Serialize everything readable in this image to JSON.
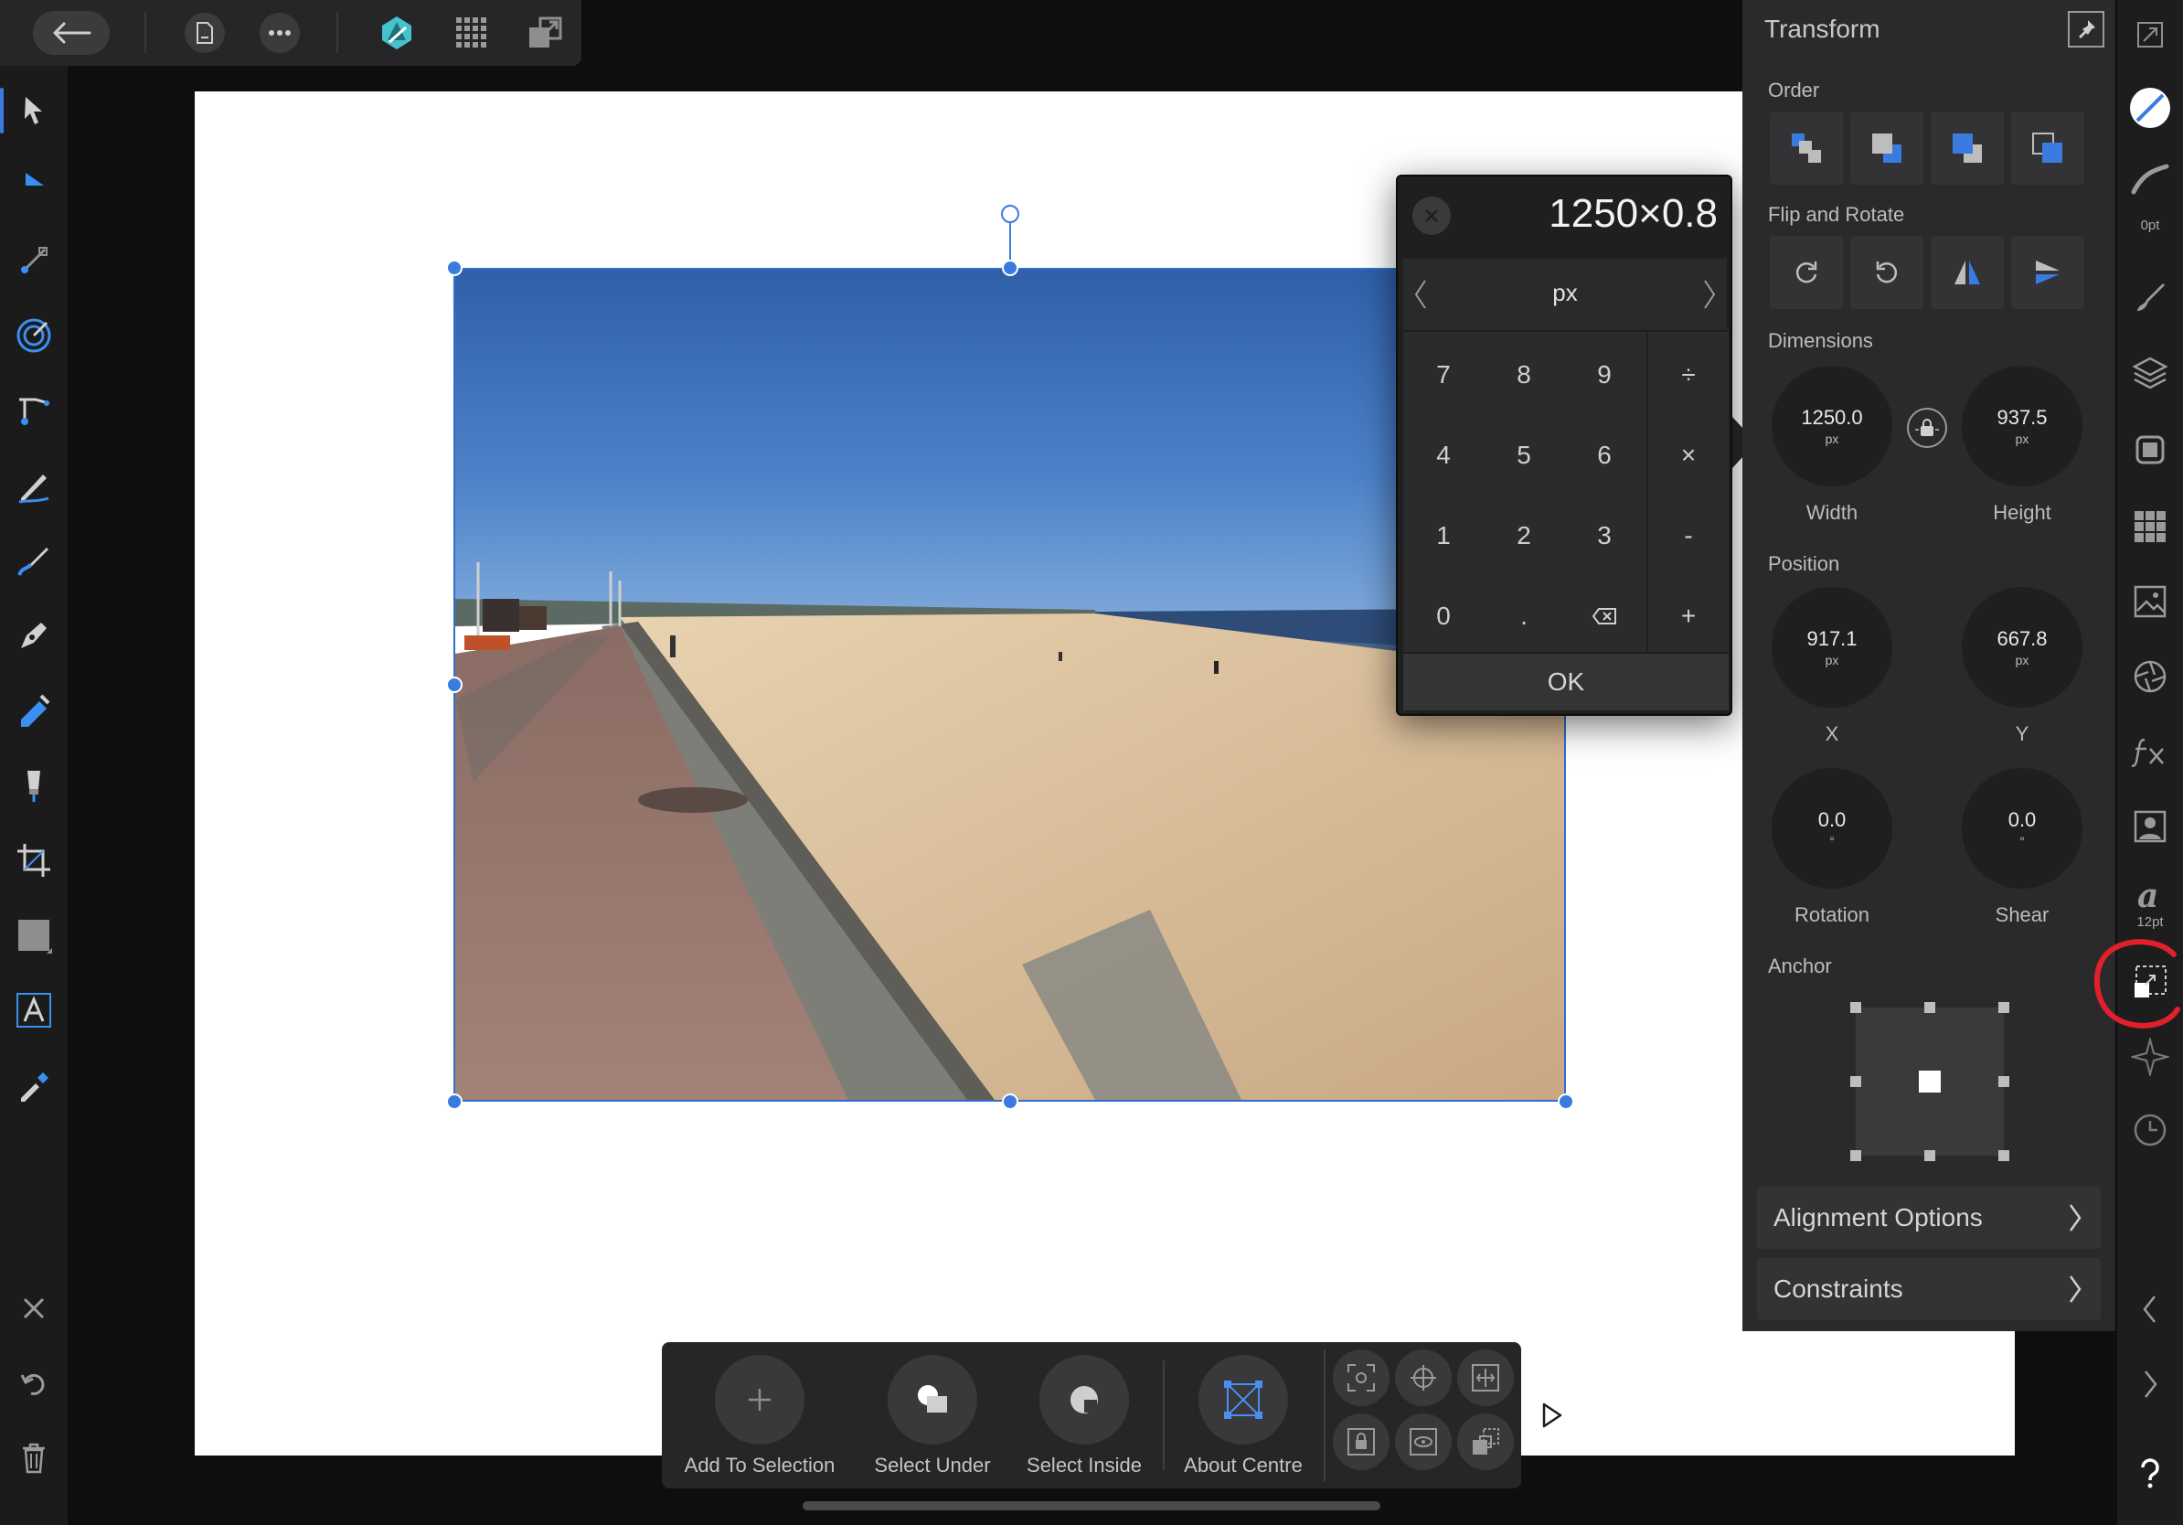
{
  "top_bar": {
    "back_icon": "back-arrow-icon",
    "document_icon": "document-icon",
    "more_icon": "more-icon",
    "persona_icon": "affinity-photo-persona-icon",
    "grid_icon": "grid-icon",
    "export_persona_icon": "export-persona-icon"
  },
  "left_tools": [
    "move-tool",
    "node-tool",
    "point-transform-tool",
    "contour-tool",
    "corner-tool",
    "pencil-tool",
    "vector-brush-tool",
    "pen-tool",
    "fill-tool",
    "transparency-tool",
    "crop-tool",
    "rectangle-tool",
    "artistic-text-tool",
    "color-picker-tool"
  ],
  "left_bottom": [
    "close-icon",
    "undo-icon",
    "delete-icon"
  ],
  "calculator": {
    "expression": "1250×0.8",
    "unit": "px",
    "keys": [
      [
        "7",
        "8",
        "9"
      ],
      [
        "4",
        "5",
        "6"
      ],
      [
        "1",
        "2",
        "3"
      ],
      [
        "0",
        "."
      ]
    ],
    "ops": [
      "÷",
      "×",
      "-",
      "+"
    ],
    "ok_label": "OK"
  },
  "transform": {
    "title": "Transform",
    "order_label": "Order",
    "flip_rotate_label": "Flip and Rotate",
    "dimensions_label": "Dimensions",
    "width": {
      "value": "1250.0",
      "unit": "px",
      "label": "Width"
    },
    "height": {
      "value": "937.5",
      "unit": "px",
      "label": "Height"
    },
    "position_label": "Position",
    "x": {
      "value": "917.1",
      "unit": "px",
      "label": "X"
    },
    "y": {
      "value": "667.8",
      "unit": "px",
      "label": "Y"
    },
    "rotation": {
      "value": "0.0",
      "unit": "°",
      "label": "Rotation"
    },
    "shear": {
      "value": "0.0",
      "unit": "°",
      "label": "Shear"
    },
    "anchor_label": "Anchor",
    "alignment_options": "Alignment Options",
    "constraints": "Constraints"
  },
  "studio_strip": {
    "stroke_width": "0pt",
    "text_size": "12pt"
  },
  "context_toolbar": {
    "add_to_selection": "Add To Selection",
    "select_under": "Select Under",
    "select_inside": "Select Inside",
    "about_centre": "About Centre"
  },
  "colors": {
    "accent": "#3a7bdf",
    "panel": "#2a2a2c",
    "annotation_red": "#e0202a"
  }
}
